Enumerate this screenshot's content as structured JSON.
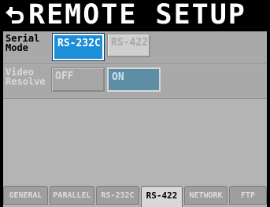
{
  "header": {
    "title": "REMOTE SETUP",
    "back_icon": "return-arrow-icon"
  },
  "serial_mode": {
    "label_line1": "Serial",
    "label_line2": "Mode",
    "options": [
      {
        "label": "RS-232C",
        "selected": true
      },
      {
        "label": "RS-422",
        "selected": false
      }
    ]
  },
  "video_resolve": {
    "label_line1": "Video",
    "label_line2": "Resolve",
    "enabled": false,
    "options": [
      {
        "label": "OFF",
        "selected": false
      },
      {
        "label": "ON",
        "selected": true
      }
    ]
  },
  "tabs": [
    {
      "label": "GENERAL",
      "active": false
    },
    {
      "label": "PARALLEL",
      "active": false
    },
    {
      "label": "RS-232C",
      "active": false
    },
    {
      "label": "RS-422",
      "active": true
    },
    {
      "label": "NETWORK",
      "active": false
    },
    {
      "label": "FTP",
      "active": false
    }
  ],
  "colors": {
    "selected_button": "#1c8fd8",
    "panel_background": "#b4b4b4",
    "header_background": "#000000"
  }
}
